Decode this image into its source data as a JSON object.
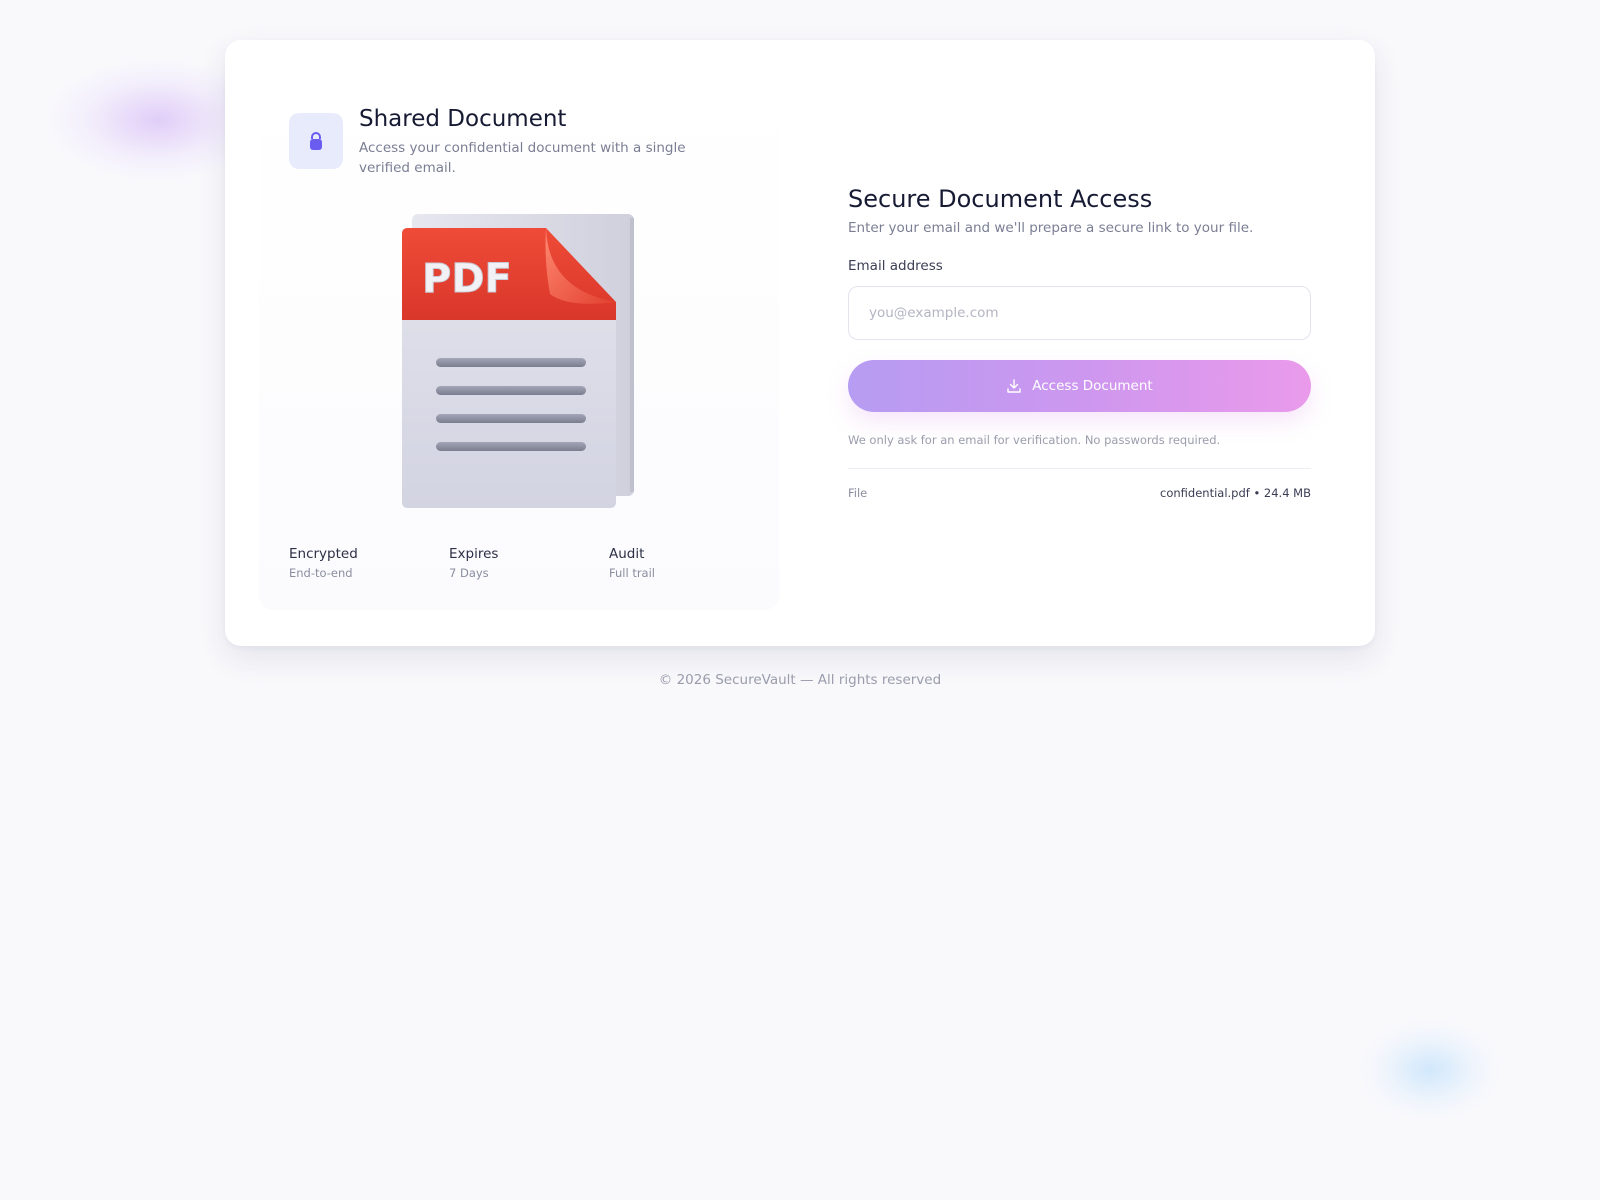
{
  "header": {
    "title": "Shared Document",
    "subtitle": "Access your confidential document with a single verified email.",
    "icon": "lock-icon"
  },
  "illustration": {
    "icon": "pdf-file-icon",
    "badge_text": "PDF",
    "colors": {
      "band": "#e8402f",
      "page": "#dcdde8"
    }
  },
  "features": [
    {
      "label": "Encrypted",
      "value": "End-to-end"
    },
    {
      "label": "Expires",
      "value": "7 Days"
    },
    {
      "label": "Audit",
      "value": "Full trail"
    }
  ],
  "form": {
    "title": "Secure Document Access",
    "subtitle": "Enter your email and we'll prepare a secure link to your file.",
    "email_label": "Email address",
    "email_placeholder": "you@example.com",
    "email_value": "",
    "button_label": "Access Document",
    "button_icon": "download-icon",
    "note": "We only ask for an email for verification. No passwords required.",
    "file_label": "File",
    "file_info": "confidential.pdf • 24.4 MB"
  },
  "footer": {
    "text": "© 2026 SecureVault — All rights reserved"
  },
  "theme": {
    "accent_start": "#b69cf2",
    "accent_end": "#ea9aeb",
    "lock_tile_bg": "#e8ebfb",
    "lock_color": "#6b5cf0",
    "background": "#f9f9fc"
  }
}
